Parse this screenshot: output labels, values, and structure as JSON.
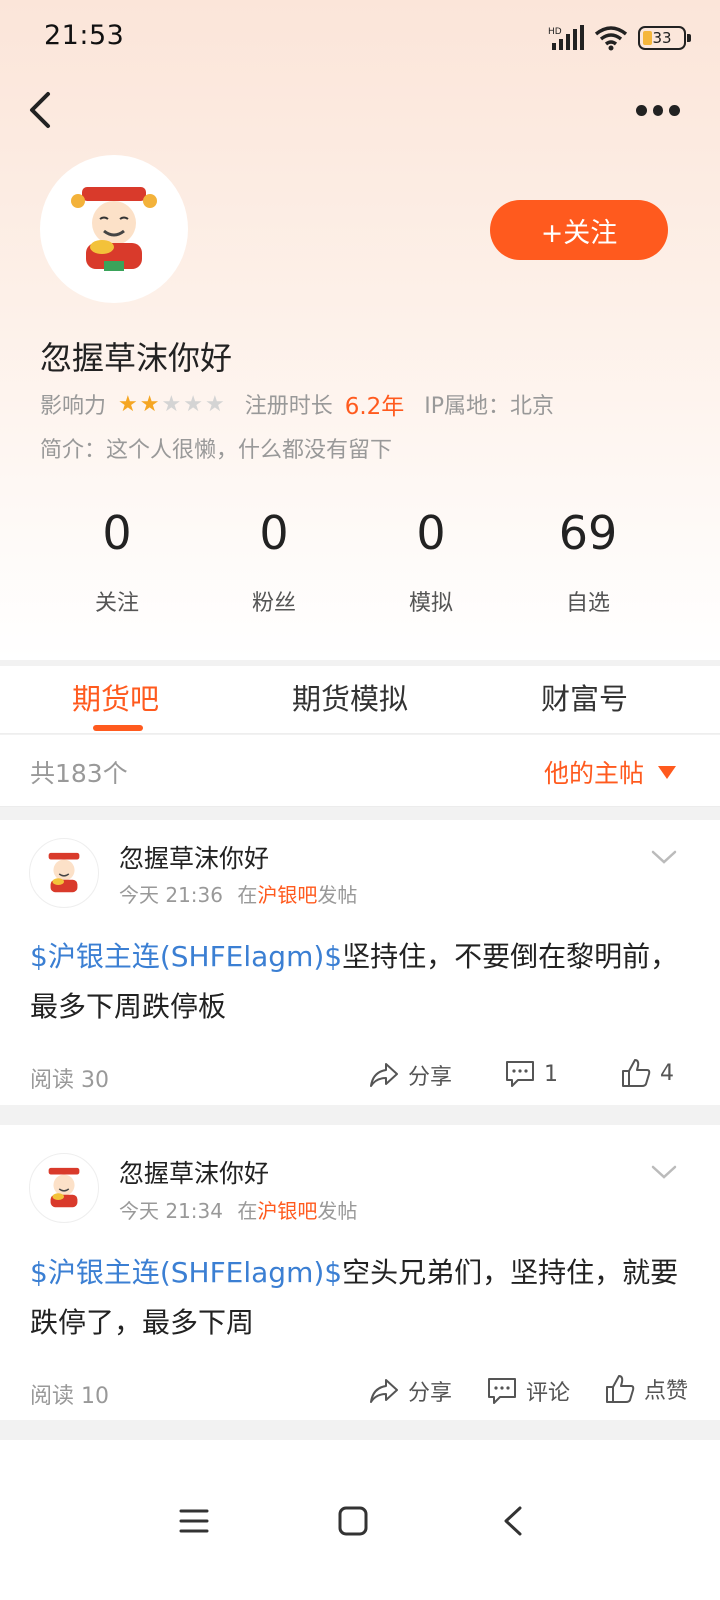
{
  "status": {
    "time": "21:53",
    "battery": "33"
  },
  "profile": {
    "name": "忽握草沫你好",
    "follow_label": "+关注",
    "influence_label": "影响力",
    "rating": 2,
    "rating_max": 5,
    "reg_label": "注册时长",
    "reg_value": "6.2年",
    "ip_label": "IP属地：北京",
    "bio": "简介：这个人很懒，什么都没有留下"
  },
  "stats": [
    {
      "value": "0",
      "label": "关注"
    },
    {
      "value": "0",
      "label": "粉丝"
    },
    {
      "value": "0",
      "label": "模拟"
    },
    {
      "value": "69",
      "label": "自选"
    }
  ],
  "tabs": [
    {
      "label": "期货吧",
      "active": true
    },
    {
      "label": "期货模拟",
      "active": false
    },
    {
      "label": "财富号",
      "active": false
    }
  ],
  "list": {
    "count": "共183个",
    "filter": "他的主帖"
  },
  "posts": [
    {
      "user": "忽握草沫你好",
      "time": "今天 21:36",
      "in": "在",
      "bar": "沪银吧",
      "posted": "发帖",
      "tag": "$沪银主连(SHFElagm)$",
      "text": "坚持住，不要倒在黎明前，最多下周跌停板",
      "reads": "阅读 30",
      "share": "分享",
      "comments": "1",
      "likes": "4"
    },
    {
      "user": "忽握草沫你好",
      "time": "今天 21:34",
      "in": "在",
      "bar": "沪银吧",
      "posted": "发帖",
      "tag": "$沪银主连(SHFElagm)$",
      "text": "空头兄弟们，坚持住，就要跌停了，最多下周",
      "reads": "阅读 10",
      "share": "分享",
      "comments": "评论",
      "likes": "点赞"
    }
  ],
  "colors": {
    "accent": "#ff5a1e",
    "link": "#3b7fd3",
    "star": "#f5a623"
  }
}
